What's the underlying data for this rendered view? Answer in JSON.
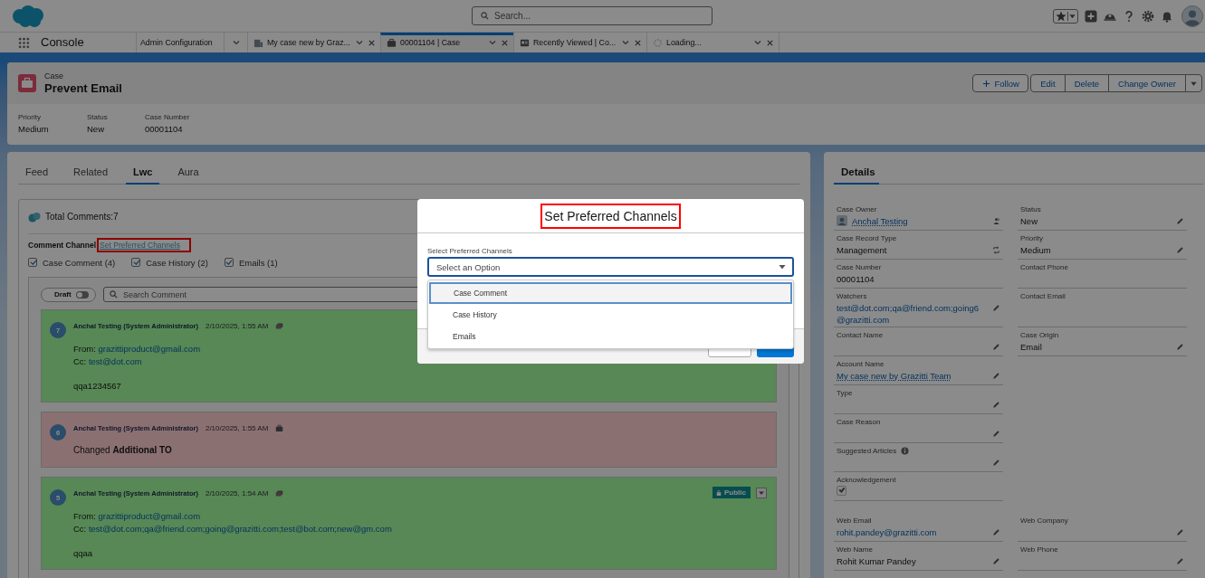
{
  "global_header": {
    "search_placeholder": "Search..."
  },
  "app": {
    "name": "Console"
  },
  "nav_tabs": [
    {
      "label": "Admin Configuration",
      "kind": "pinned",
      "selected": false
    },
    {
      "label": "My case new by Graz...",
      "kind": "closable",
      "selected": false
    },
    {
      "label": "00001104 | Case",
      "kind": "closable",
      "selected": true
    },
    {
      "label": "Recently Viewed | Co...",
      "kind": "closable",
      "selected": false
    },
    {
      "label": "Loading...",
      "kind": "closable",
      "selected": false
    }
  ],
  "record": {
    "object": "Case",
    "title": "Prevent Email",
    "actions": [
      {
        "label": "Follow",
        "kind": "follow"
      },
      {
        "label": "Edit",
        "kind": "group"
      },
      {
        "label": "Delete",
        "kind": "group"
      },
      {
        "label": "Change Owner",
        "kind": "group"
      },
      {
        "kind": "menu"
      }
    ],
    "highlights": [
      {
        "label": "Priority",
        "value": "Medium"
      },
      {
        "label": "Status",
        "value": "New"
      },
      {
        "label": "Case Number",
        "value": "00001104"
      }
    ]
  },
  "record_tabs": [
    {
      "label": "Feed",
      "selected": false
    },
    {
      "label": "Related",
      "selected": false
    },
    {
      "label": "Lwc",
      "selected": true
    },
    {
      "label": "Aura",
      "selected": false
    }
  ],
  "comments_panel": {
    "total": "Total Comments:7",
    "channel_label": "Comment Channel",
    "channel_link": "Set Preferred Channels",
    "channel_link_annotated": true,
    "filters": [
      {
        "label": "Case Comment (4)",
        "checked": true
      },
      {
        "label": "Case History (2)",
        "checked": true
      },
      {
        "label": "Emails (1)",
        "checked": true
      }
    ],
    "draft_label": "Draft",
    "draft_on": false,
    "search_placeholder": "Search Comment",
    "comments": [
      {
        "kind": "email",
        "number": "7",
        "author": "Anchal Testing (System Administrator)",
        "date": "2/10/2025, 1:55 AM",
        "lines": [
          {
            "label": "From:",
            "value": "grazittiproduct@gmail.com"
          },
          {
            "label": "Cc:",
            "value": "test@dot.com"
          }
        ],
        "body": "qqa1234567"
      },
      {
        "kind": "history",
        "number": "6",
        "author": "Anchal Testing (System Administrator)",
        "date": "2/10/2025, 1:55 AM",
        "text": "Changed **Additional TO**"
      },
      {
        "kind": "email",
        "number": "5",
        "author": "Anchal Testing (System Administrator)",
        "date": "2/10/2025, 1:54 AM",
        "badge": "Public",
        "lines": [
          {
            "label": "From:",
            "value": "grazittiproduct@gmail.com"
          },
          {
            "label": "Cc:",
            "value": "test@dot.com;qa@friend.com;going@grazitti.com;test@bot.com;new@gm.com"
          }
        ],
        "body": "qqaa"
      }
    ]
  },
  "details": {
    "title": "Details",
    "rows": [
      {
        "spaced": false,
        "cells": [
          {
            "label": "Case Owner",
            "kind": "user",
            "value": "Anchal Testing",
            "editable": false
          },
          {
            "label": "Status",
            "kind": "text",
            "value": "New",
            "editable": true
          }
        ]
      },
      {
        "spaced": false,
        "cells": [
          {
            "label": "Case Record Type",
            "kind": "record_type",
            "value": "Management",
            "editable": false
          },
          {
            "label": "Priority",
            "kind": "text",
            "value": "Medium",
            "editable": true
          }
        ]
      },
      {
        "spaced": false,
        "cells": [
          {
            "label": "Case Number",
            "kind": "text",
            "value": "00001104",
            "editable": false
          },
          {
            "label": "Contact Phone",
            "kind": "text",
            "editable": false
          }
        ]
      },
      {
        "spaced": false,
        "cells": [
          {
            "label": "Watchers",
            "kind": "email",
            "value": "test@dot.com;qa@friend.com;going6@grazitti.com",
            "editable": true
          },
          {
            "label": "Contact Email",
            "kind": "text",
            "editable": false
          }
        ]
      },
      {
        "spaced": false,
        "cells": [
          {
            "label": "Contact Name",
            "kind": "text",
            "editable": true
          },
          {
            "label": "Case Origin",
            "kind": "text",
            "value": "Email",
            "editable": true
          }
        ]
      },
      {
        "spaced": false,
        "cells": [
          {
            "label": "Account Name",
            "kind": "link",
            "value": "My case new by Grazitti Team",
            "editable": true
          }
        ]
      },
      {
        "spaced": false,
        "cells": [
          {
            "label": "Type",
            "kind": "text",
            "editable": true
          }
        ]
      },
      {
        "spaced": false,
        "cells": [
          {
            "label": "Case Reason",
            "kind": "text",
            "editable": true
          }
        ]
      },
      {
        "spaced": false,
        "cells": [
          {
            "label": "Suggested Articles",
            "kind": "text",
            "info": true,
            "editable": true
          }
        ]
      },
      {
        "spaced": false,
        "cells": [
          {
            "label": "Acknowledgement",
            "kind": "checkbox",
            "checked": true,
            "editable": false
          }
        ]
      },
      {
        "spaced": true,
        "cells": [
          {
            "label": "Web Email",
            "kind": "email",
            "value": "rohit.pandey@grazitti.com",
            "editable": true
          },
          {
            "label": "Web Company",
            "kind": "text",
            "editable": true
          }
        ]
      },
      {
        "spaced": false,
        "cells": [
          {
            "label": "Web Name",
            "kind": "text",
            "value": "Rohit Kumar Pandey",
            "editable": true
          },
          {
            "label": "Web Phone",
            "kind": "text",
            "editable": true
          }
        ]
      }
    ]
  },
  "modal": {
    "title": "Set Preferred Channels",
    "title_annotated": true,
    "field_label": "Select Preferred Channels",
    "placeholder": "Select an Option",
    "options": [
      {
        "label": "Case Comment",
        "selected": true
      },
      {
        "label": "Case History",
        "selected": false
      },
      {
        "label": "Emails",
        "selected": false
      }
    ]
  }
}
